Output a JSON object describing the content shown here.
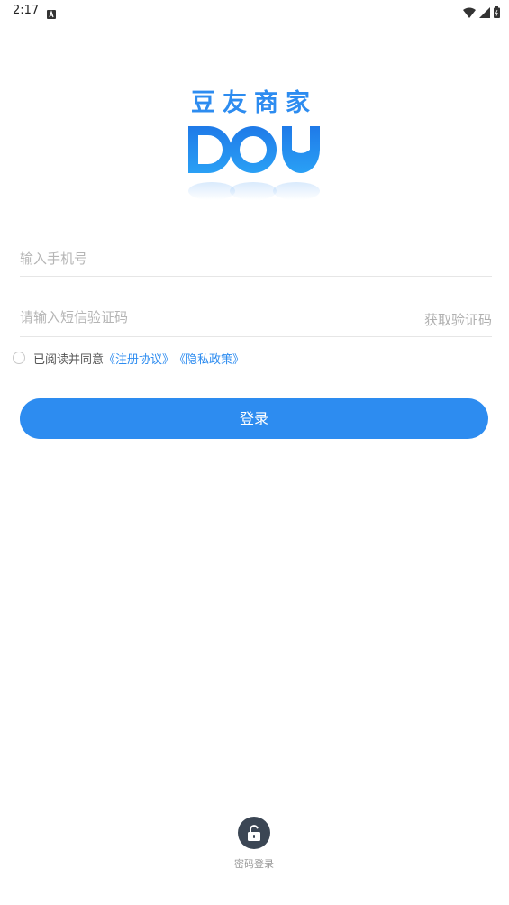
{
  "status_bar": {
    "time": "2:17",
    "notification_icon": "a-notification-icon",
    "right_icons": [
      "wifi-icon",
      "signal-icon",
      "battery-icon"
    ]
  },
  "brand": {
    "title": "豆友商家",
    "logo_icon": "dou-logo",
    "accent_color": "#2d8cf0"
  },
  "form": {
    "phone_placeholder": "输入手机号",
    "phone_value": "",
    "code_placeholder": "请输入短信验证码",
    "code_value": "",
    "get_code_label": "获取验证码"
  },
  "agreement": {
    "checked": false,
    "prefix": "已阅读并同意",
    "register_link": "《注册协议》",
    "privacy_link": "《隐私政策》"
  },
  "login_button": {
    "label": "登录"
  },
  "password_login": {
    "icon": "unlock-icon",
    "label": "密码登录"
  }
}
